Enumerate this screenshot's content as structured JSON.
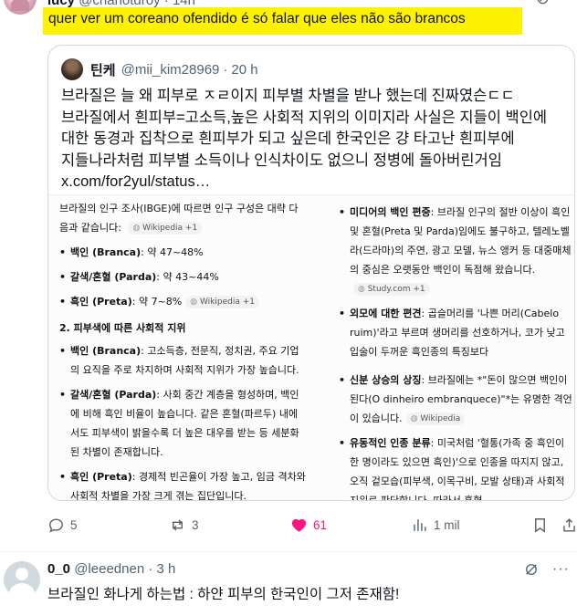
{
  "top_post": {
    "name": "lucy",
    "handle": "@charlotdroy",
    "time": "14h",
    "text": "quer ver um coreano ofendido é só falar que eles não são brancos",
    "highlight_color": "#fff200",
    "actions": {
      "replies": "5",
      "reposts": "3",
      "likes": "61",
      "views": "1 mil",
      "like_color": "#f91880"
    }
  },
  "quote": {
    "name": "틴케",
    "handle": "@mii_kim28969",
    "time": "20 h",
    "text": "브라질은 늘 왜 피부로 ㅈㄹ이지 피부별 차별을 받나 했는데 진짜였슨ㄷㄷ 브라질에서 흰피부=고소득,높은 사회적 지위의 이미지라 사실은 지들이 백인에 대한 동경과 집착으로 흰피부가 되고 싶은데 한국인은 걍 타고난 흰피부에 지들나라처럼 피부별 소득이나 인식차이도 없으니 정병에 돌아버린거임",
    "link": "x.com/for2yul/status…",
    "media": {
      "left_intro": "브라질의 인구 조사(IBGE)에 따르면 인구 구성은 대략 다음과 같습니다:",
      "left_intro_chip": "Wikipedia +1",
      "stats": [
        {
          "label": "백인 (Branca)",
          "value": ": 약 47~48%",
          "chip": ""
        },
        {
          "label": "갈색/혼혈 (Parda)",
          "value": ": 약 43~44%",
          "chip": ""
        },
        {
          "label": "흑인 (Preta)",
          "value": ": 약 7~8%",
          "chip": "Wikipedia +1"
        }
      ],
      "section_title": "2. 피부색에 따른 사회적 지위",
      "left_items": [
        {
          "label": "백인 (Branca)",
          "text": ": 고소득층, 전문직, 정치권, 주요 기업의 요직을 주로 차지하며 사회적 지위가 가장 높습니다."
        },
        {
          "label": "갈색/혼혈 (Parda)",
          "text": ": 사회 중간 계층을 형성하며, 백인에 비해 흑인 비율이 높습니다. 같은 혼혈(파르두) 내에서도 피부색이 밝을수록 더 높은 대우를 받는 등 세분화된 차별이 존재합니다."
        },
        {
          "label": "흑인 (Preta)",
          "text": ": 경제적 빈곤율이 가장 높고, 임금 격차와 사회적 차별을 가장 크게 겪는 집단입니다."
        }
      ],
      "right_items": [
        {
          "label": "미디어의 백인 편중",
          "text": ": 브라질 인구의 절반 이상이 흑인 및 혼혈(Preta 및 Parda)임에도 불구하고, 텔레노벨라(드라마)의 주연, 광고 모델, 뉴스 앵커 등 대중매체의 중심은 오랫동안 백인이 독점해 왔습니다.",
          "chip": "Study.com +1"
        },
        {
          "label": "외모에 대한 편견",
          "text": ": 곱슬머리를 '나쁜 머리(Cabelo ruim)'라고 부르며 생머리를 선호하거나, 코가 낮고 입술이 두꺼운 흑인종의 특징보다",
          "chip": ""
        },
        {
          "label": "신분 상승의 상징",
          "text": ": 브라질에는 *\"돈이 많으면 백인이 된다(O dinheiro embranquece)\"*는 유명한 격언이 있습니다.",
          "chip": "Wikipedia"
        },
        {
          "label": "유동적인 인종 분류",
          "text": ": 미국처럼 '혈통(가족 중 흑인이 한 명이라도 있으면 흑인)'으로 인종을 따지지 않고, 오직 겉모습(피부색, 이목구비, 모발 상태)과 사회적 지위로 판단합니다. 따라서 혼혈",
          "chip": ""
        }
      ]
    }
  },
  "reply": {
    "name": "0_0",
    "handle": "@leeednen",
    "time": "3 h",
    "text": "브라질인 화나게 하는법 : 하얀 피부의 한국인이 그저 존재함!"
  },
  "icons": [
    "more-icon",
    "reply-icon",
    "repost-icon",
    "like-icon",
    "views-icon",
    "bookmark-icon",
    "share-icon",
    "grok-icon"
  ]
}
